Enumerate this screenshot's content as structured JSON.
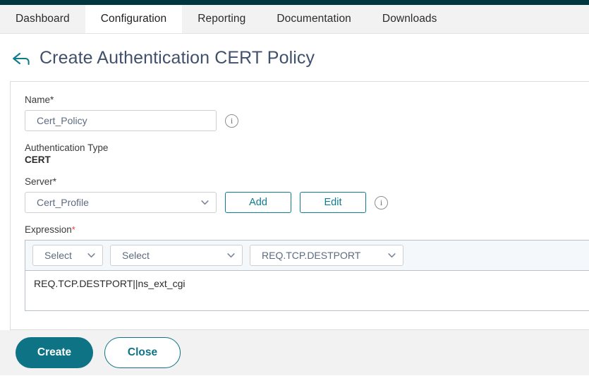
{
  "tabs": [
    {
      "label": "Dashboard",
      "active": false
    },
    {
      "label": "Configuration",
      "active": true
    },
    {
      "label": "Reporting",
      "active": false
    },
    {
      "label": "Documentation",
      "active": false
    },
    {
      "label": "Downloads",
      "active": false
    }
  ],
  "header": {
    "title": "Create Authentication CERT Policy",
    "back_icon": "arrow-left-icon"
  },
  "form": {
    "name": {
      "label": "Name*",
      "value": "Cert_Policy",
      "placeholder": "",
      "info_icon": "info-icon"
    },
    "auth_type": {
      "label": "Authentication Type",
      "value": "CERT"
    },
    "server": {
      "label": "Server*",
      "selected": "Cert_Profile",
      "add_label": "Add",
      "edit_label": "Edit",
      "info_icon": "info-icon",
      "chevron_icon": "chevron-down-icon"
    },
    "expression": {
      "label": "Expression",
      "required_marker": "*",
      "selector_1": "Select",
      "selector_2": "Select",
      "selector_3": "REQ.TCP.DESTPORT",
      "value": "REQ.TCP.DESTPORT||ns_ext_cgi",
      "chevron_icon": "chevron-down-icon"
    }
  },
  "footer": {
    "create_label": "Create",
    "close_label": "Close"
  },
  "colors": {
    "brand_teal": "#0e7384",
    "top_strip": "#00373f",
    "title_text": "#41506b",
    "required_red": "#e8413c",
    "toolbar_bg": "#f4f8fb"
  }
}
